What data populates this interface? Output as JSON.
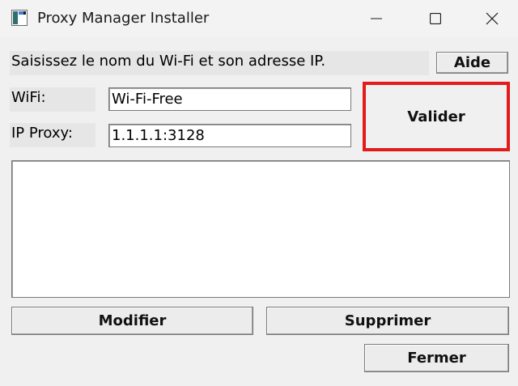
{
  "window": {
    "title": "Proxy Manager Installer"
  },
  "header": {
    "instruction": "Saisissez le nom du Wi-Fi et son adresse IP.",
    "help_label": "Aide"
  },
  "form": {
    "wifi_label": "WiFi:",
    "wifi_value": "Wi-Fi-Free",
    "ip_label": "IP Proxy:",
    "ip_value": "1.1.1.1:3128",
    "validate_label": "Valider"
  },
  "list": {
    "items": []
  },
  "actions": {
    "modify_label": "Modifier",
    "delete_label": "Supprimer",
    "close_label": "Fermer"
  },
  "colors": {
    "highlight": "#e31b1b",
    "background": "#f0f0f0"
  },
  "icons": {
    "app": "app-window-icon",
    "minimize": "minimize-icon",
    "maximize": "maximize-icon",
    "close": "close-icon"
  }
}
